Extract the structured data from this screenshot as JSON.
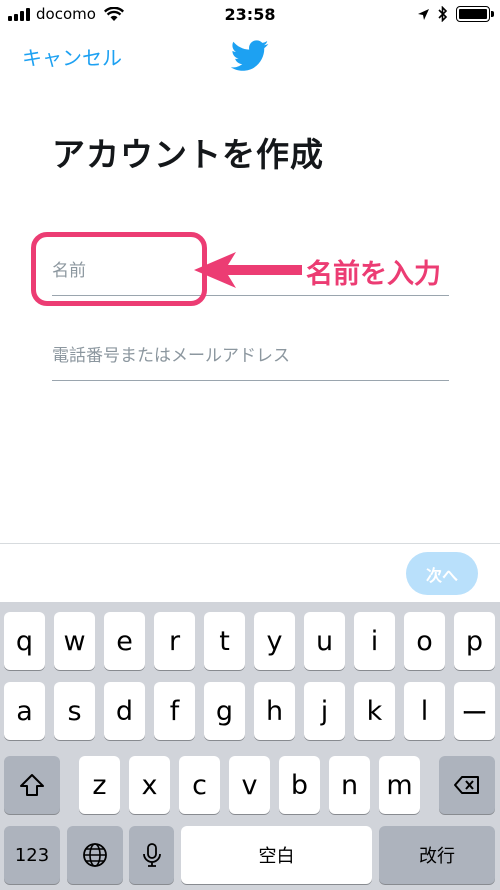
{
  "status_bar": {
    "carrier": "docomo",
    "time": "23:58"
  },
  "nav": {
    "cancel_label": "キャンセル"
  },
  "page": {
    "title": "アカウントを作成"
  },
  "form": {
    "name_placeholder": "名前",
    "phone_placeholder": "電話番号またはメールアドレス"
  },
  "annotation": {
    "text": "名前を入力",
    "color": "#ec3c73"
  },
  "footer": {
    "next_label": "次へ"
  },
  "keyboard": {
    "row1": [
      "q",
      "w",
      "e",
      "r",
      "t",
      "y",
      "u",
      "i",
      "o",
      "p"
    ],
    "row2": [
      "a",
      "s",
      "d",
      "f",
      "g",
      "h",
      "j",
      "k",
      "l",
      "ー"
    ],
    "row3": [
      "z",
      "x",
      "c",
      "v",
      "b",
      "n",
      "m"
    ],
    "numbers_label": "123",
    "space_label": "空白",
    "return_label": "改行"
  },
  "colors": {
    "accent": "#1da1f2",
    "keyboard_bg": "#d1d4da"
  },
  "icons": [
    "wifi-icon",
    "location-icon",
    "bluetooth-icon",
    "battery-icon",
    "twitter-bird-icon",
    "shift-icon",
    "delete-icon",
    "globe-icon",
    "microphone-icon"
  ]
}
